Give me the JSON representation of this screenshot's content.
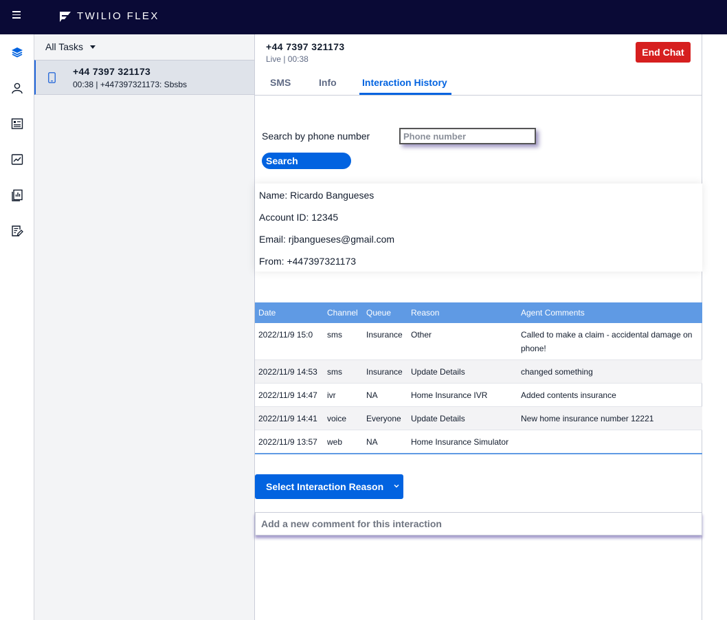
{
  "app": {
    "brand": "TWILIO FLEX",
    "accent": "#0263e0",
    "topbar_color": "#0a0a36"
  },
  "sidenav": {
    "items": [
      {
        "icon": "layers-icon",
        "active": true
      },
      {
        "icon": "teams-icon"
      },
      {
        "icon": "contact-card-icon"
      },
      {
        "icon": "insights-chart-icon"
      },
      {
        "icon": "reports-icon"
      },
      {
        "icon": "edit-document-icon"
      }
    ]
  },
  "tasklist": {
    "filter_label": "All Tasks",
    "tasks": [
      {
        "title": "+44 7397 321173",
        "subtitle": "00:38 | +447397321173: Sbsbs",
        "icon": "mobile-phone-icon"
      }
    ]
  },
  "header": {
    "title": "+44 7397 321173",
    "status": "Live | 00:38",
    "end_chat_label": "End Chat"
  },
  "tabs": [
    {
      "label": "SMS"
    },
    {
      "label": "Info"
    },
    {
      "label": "Interaction History",
      "active": true
    }
  ],
  "search": {
    "label": "Search by phone number",
    "placeholder": "Phone number",
    "button_label": "Search"
  },
  "customer": {
    "name": "Name: Ricardo Bangueses",
    "account": "Account ID: 12345",
    "email": "Email: rjbangueses@gmail.com",
    "from": "From: +447397321173"
  },
  "history": {
    "columns": [
      "Date",
      "Channel",
      "Queue",
      "Reason",
      "Agent Comments"
    ],
    "rows": [
      [
        "2022/11/9 15:0",
        "sms",
        "Insurance",
        "Other",
        "Called to make a claim - accidental damage on phone!"
      ],
      [
        "2022/11/9 14:53",
        "sms",
        "Insurance",
        "Update Details",
        "changed something"
      ],
      [
        "2022/11/9 14:47",
        "ivr",
        "NA",
        "Home Insurance IVR",
        "Added contents insurance"
      ],
      [
        "2022/11/9 14:41",
        "voice",
        "Everyone",
        "Update Details",
        "New home insurance number 12221"
      ],
      [
        "2022/11/9 13:57",
        "web",
        "NA",
        "Home Insurance Simulator",
        ""
      ]
    ]
  },
  "interaction": {
    "reason_label": "Select Interaction Reason",
    "comment_placeholder": "Add a new comment for this interaction"
  }
}
